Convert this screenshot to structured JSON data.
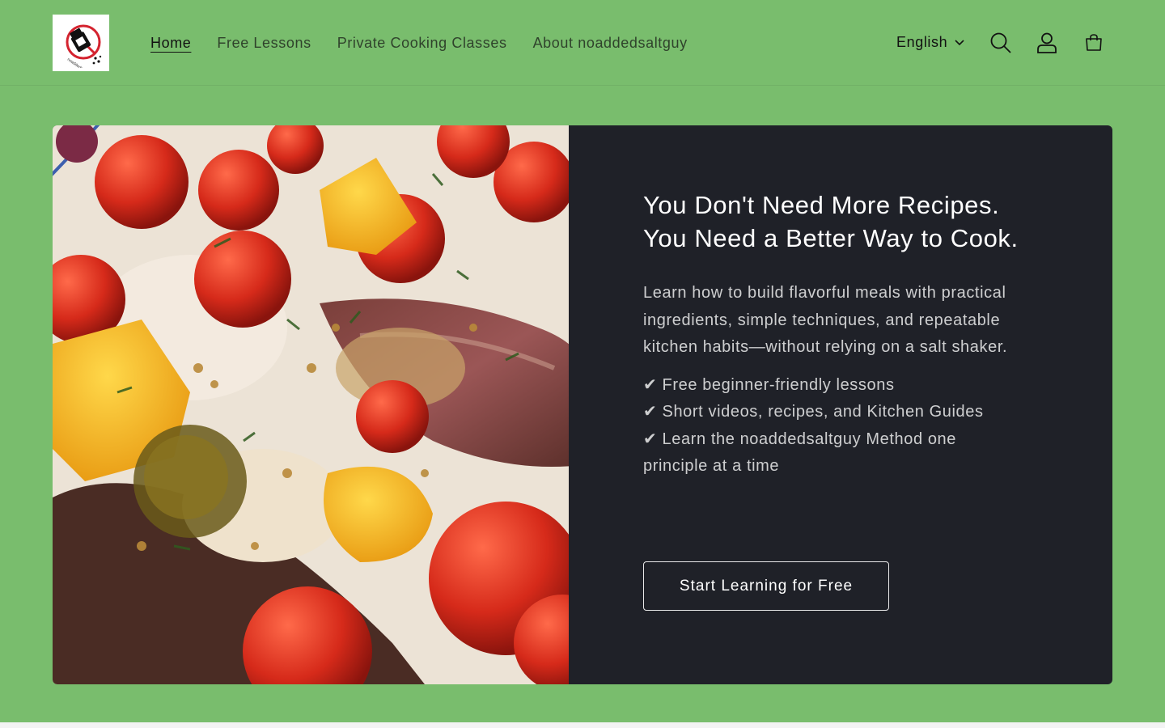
{
  "header": {
    "logo_alt": "noaddedsaltguy",
    "logo_text": "noaddedsaltguy",
    "nav": [
      {
        "label": "Home",
        "active": true
      },
      {
        "label": "Free Lessons",
        "active": false
      },
      {
        "label": "Private Cooking Classes",
        "active": false
      },
      {
        "label": "About noaddedsaltguy",
        "active": false
      }
    ],
    "language": "English",
    "icons": [
      "search-icon",
      "account-icon",
      "cart-icon"
    ]
  },
  "hero": {
    "heading_line1": "You Don't Need More Recipes.",
    "heading_line2": "You Need a Better Way to Cook.",
    "description": "Learn how to build flavorful meals with practical ingredients, simple techniques, and repeatable kitchen habits—without relying on a salt shaker.",
    "checklist": [
      "✔ Free beginner-friendly lessons",
      "✔ Short videos, recipes, and Kitchen Guides",
      "✔ Learn the noaddedsaltguy Method one principle at a time"
    ],
    "cta_label": "Start Learning for Free"
  },
  "colors": {
    "page_background": "#79bd6d",
    "banner_background": "#1f2128",
    "text_dark": "#121212",
    "text_light": "#ffffff"
  }
}
